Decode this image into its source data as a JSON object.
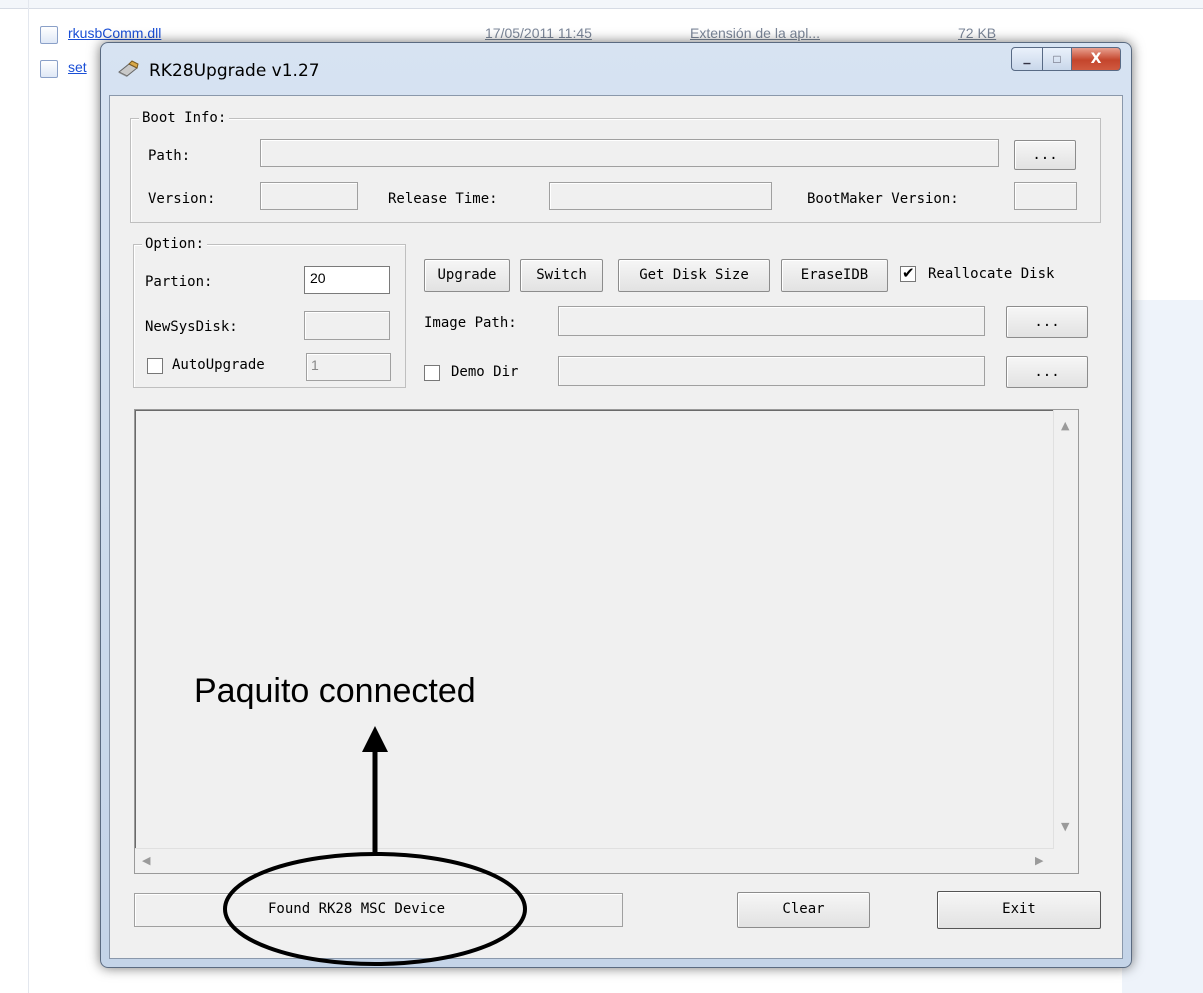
{
  "explorer": {
    "files": [
      {
        "name": "rkusbComm.dll",
        "date": "17/05/2011 11:45",
        "type": "Extensión de la apl...",
        "size": "72 KB"
      },
      {
        "name": "set",
        "date": "",
        "type": "",
        "size": ""
      }
    ]
  },
  "window": {
    "title": "RK28Upgrade v1.27",
    "minimize_label": "▁",
    "maximize_label": "□",
    "close_label": "X"
  },
  "boot_info": {
    "group_title": "Boot Info:",
    "path_label": "Path:",
    "path_value": "",
    "browse_label": "...",
    "version_label": "Version:",
    "version_value": "",
    "release_time_label": "Release Time:",
    "release_time_value": "",
    "bootmaker_label": "BootMaker Version:",
    "bootmaker_value": ""
  },
  "option": {
    "group_title": "Option:",
    "partion_label": "Partion:",
    "partion_value": "20",
    "newsysdisk_label": "NewSysDisk:",
    "newsysdisk_value": "",
    "autoupgrade_label": "AutoUpgrade",
    "autoupgrade_checked": false,
    "autoupgrade_value": "1"
  },
  "actions": {
    "upgrade_label": "Upgrade",
    "switch_label": "Switch",
    "get_disk_size_label": "Get Disk Size",
    "eraseidb_label": "EraseIDB",
    "reallocate_label": "Reallocate Disk",
    "reallocate_checked": true,
    "image_path_label": "Image Path:",
    "image_path_value": "",
    "image_browse_label": "...",
    "demo_dir_label": "Demo Dir",
    "demo_dir_checked": false,
    "demo_dir_value": "",
    "demo_browse_label": "..."
  },
  "log": {
    "scroll_up": "▲",
    "scroll_down": "▼",
    "scroll_left": "◀",
    "scroll_right": "▶"
  },
  "status": {
    "text": "Found RK28 MSC Device",
    "clear_label": "Clear",
    "exit_label": "Exit"
  },
  "annotation": {
    "text": "Paquito connected"
  },
  "icons": {
    "app": "usb-drive-icon",
    "file1": "dll-file-icon",
    "file2": "settings-file-icon"
  }
}
